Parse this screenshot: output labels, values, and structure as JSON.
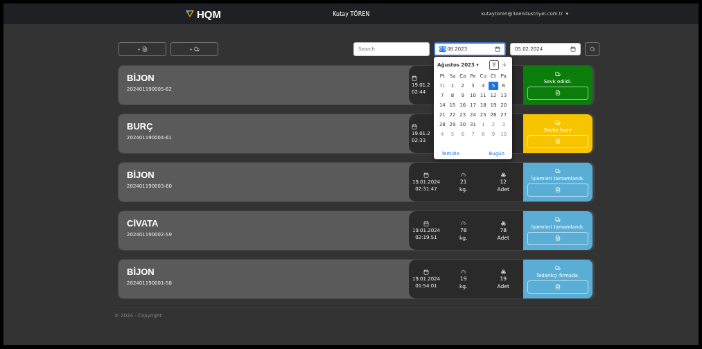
{
  "navbar": {
    "logo": "HQM",
    "user_name": "Kutay TÖREN",
    "email": "kutaytoren@3eendustriyel.com.tr",
    "menu_caret": "▾"
  },
  "toolbar": {
    "buttons": [
      {
        "kind": "file",
        "label": "+"
      },
      {
        "kind": "truck",
        "label": "+"
      }
    ],
    "search": {
      "placeholder": "Search"
    },
    "date_from": {
      "value_selected": "05",
      "value_rest": ".08.2023",
      "focused": true
    },
    "date_to": {
      "value_rest": "05.02.2024",
      "focused": false
    }
  },
  "calendar": {
    "month": "Ağustos 2023 ▾",
    "weekdays": [
      "Pt",
      "Sa",
      "Ça",
      "Pe",
      "Cu",
      "Ct",
      "Pa"
    ],
    "weeks": [
      [
        {
          "label": "31",
          "muted": true,
          "selected": false
        },
        {
          "label": "1",
          "muted": false,
          "selected": false
        },
        {
          "label": "2",
          "muted": false,
          "selected": false
        },
        {
          "label": "3",
          "muted": false,
          "selected": false
        },
        {
          "label": "4",
          "muted": false,
          "selected": false
        },
        {
          "label": "5",
          "muted": false,
          "selected": true
        },
        {
          "label": "6",
          "muted": false,
          "selected": false
        }
      ],
      [
        {
          "label": "7",
          "muted": false,
          "selected": false
        },
        {
          "label": "8",
          "muted": false,
          "selected": false
        },
        {
          "label": "9",
          "muted": false,
          "selected": false
        },
        {
          "label": "10",
          "muted": false,
          "selected": false
        },
        {
          "label": "11",
          "muted": false,
          "selected": false
        },
        {
          "label": "12",
          "muted": false,
          "selected": false
        },
        {
          "label": "13",
          "muted": false,
          "selected": false
        }
      ],
      [
        {
          "label": "14",
          "muted": false,
          "selected": false
        },
        {
          "label": "15",
          "muted": false,
          "selected": false
        },
        {
          "label": "16",
          "muted": false,
          "selected": false
        },
        {
          "label": "17",
          "muted": false,
          "selected": false
        },
        {
          "label": "18",
          "muted": false,
          "selected": false
        },
        {
          "label": "19",
          "muted": false,
          "selected": false
        },
        {
          "label": "20",
          "muted": false,
          "selected": false
        }
      ],
      [
        {
          "label": "21",
          "muted": false,
          "selected": false
        },
        {
          "label": "22",
          "muted": false,
          "selected": false
        },
        {
          "label": "23",
          "muted": false,
          "selected": false
        },
        {
          "label": "24",
          "muted": false,
          "selected": false
        },
        {
          "label": "25",
          "muted": false,
          "selected": false
        },
        {
          "label": "26",
          "muted": false,
          "selected": false
        },
        {
          "label": "27",
          "muted": false,
          "selected": false
        }
      ],
      [
        {
          "label": "28",
          "muted": false,
          "selected": false
        },
        {
          "label": "29",
          "muted": false,
          "selected": false
        },
        {
          "label": "30",
          "muted": false,
          "selected": false
        },
        {
          "label": "31",
          "muted": false,
          "selected": false
        },
        {
          "label": "1",
          "muted": true,
          "selected": false
        },
        {
          "label": "2",
          "muted": true,
          "selected": false
        },
        {
          "label": "3",
          "muted": true,
          "selected": false
        }
      ],
      [
        {
          "label": "4",
          "muted": true,
          "selected": false
        },
        {
          "label": "5",
          "muted": true,
          "selected": false
        },
        {
          "label": "6",
          "muted": true,
          "selected": false
        },
        {
          "label": "7",
          "muted": true,
          "selected": false
        },
        {
          "label": "8",
          "muted": true,
          "selected": false
        },
        {
          "label": "9",
          "muted": true,
          "selected": false
        },
        {
          "label": "10",
          "muted": true,
          "selected": false
        }
      ]
    ],
    "clear": "Temizle",
    "today": "Bugün"
  },
  "orders": [
    {
      "name": "BİJON",
      "code": "202401190005-62",
      "date": "19.01.2",
      "time": "02:44",
      "status": "Sevk edildi.",
      "color": "#0b7d0b"
    },
    {
      "name": "BURÇ",
      "code": "202401190004-61",
      "date": "19.01.2",
      "time": "02:33",
      "status": "Sevke hazır",
      "color": "#f7c400"
    },
    {
      "name": "BİJON",
      "code": "202401190003-60",
      "date": "19.01.2024",
      "time": "02:31:47",
      "weight": "21",
      "weight_unit": "kg.",
      "count": "12",
      "count_unit": "Adet",
      "status": "İşlemleri tamamlandı.",
      "color": "#5aaed6"
    },
    {
      "name": "CİVATA",
      "code": "202401190002-59",
      "date": "19.01.2024",
      "time": "02:19:51",
      "weight": "78",
      "weight_unit": "kg.",
      "count": "78",
      "count_unit": "Adet",
      "status": "İşlemleri tamamlandı.",
      "color": "#5aaed6"
    },
    {
      "name": "BİJON",
      "code": "202401190001-58",
      "date": "19.01.2024",
      "time": "01:54:01",
      "weight": "19",
      "weight_unit": "kg.",
      "count": "19",
      "count_unit": "Adet",
      "status": "Tedarikçi firmada.",
      "color": "#5aaed6"
    }
  ],
  "footer": "© 2024 - Copyright"
}
